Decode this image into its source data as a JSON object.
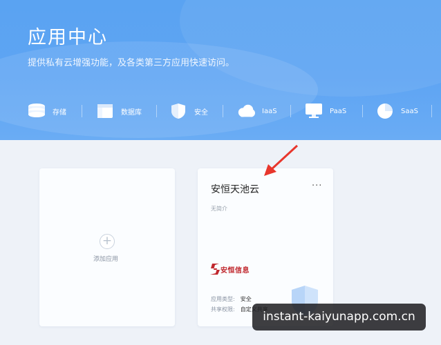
{
  "header": {
    "title": "应用中心",
    "subtitle": "提供私有云增强功能，及各类第三方应用快速访问。"
  },
  "categories": [
    {
      "label": "存储",
      "icon": "storage-icon"
    },
    {
      "label": "数据库",
      "icon": "database-icon"
    },
    {
      "label": "安全",
      "icon": "shield-icon"
    },
    {
      "label": "IaaS",
      "icon": "cloud-icon"
    },
    {
      "label": "PaaS",
      "icon": "monitor-icon"
    },
    {
      "label": "SaaS",
      "icon": "pie-icon"
    }
  ],
  "add_card": {
    "label": "添加应用",
    "icon": "plus-icon"
  },
  "app_card": {
    "title": "安恒天池云",
    "more": "···",
    "description": "无简介",
    "logo_text": "安恒信息",
    "type_label": "应用类型:",
    "type_value": "安全",
    "share_label": "共享权限:",
    "share_value": "自定义共享"
  },
  "watermark": "instant-kaiyunapp.com.cn",
  "colors": {
    "banner": "#5ea4f3",
    "arrow": "#e8362c",
    "logo": "#c0272d"
  }
}
